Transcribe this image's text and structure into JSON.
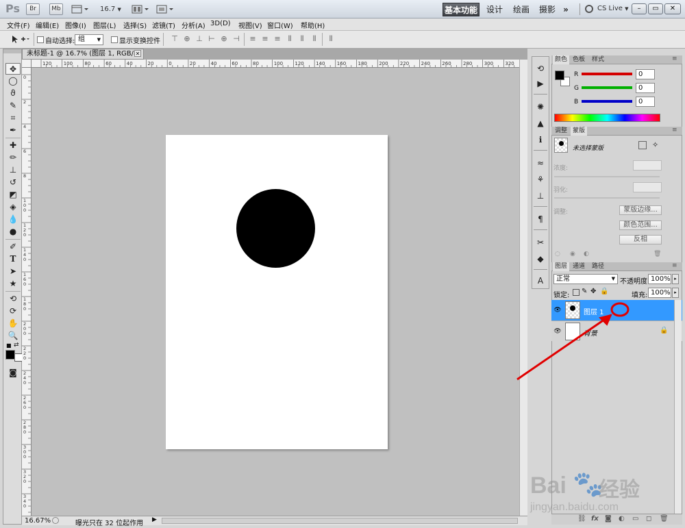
{
  "app": {
    "logo": "Ps",
    "bridge_btn": "Br",
    "minibridge_btn": "Mb",
    "zoom_value": "16.7",
    "zoom_arrow": "▼",
    "workspaces": [
      {
        "label": "基本功能",
        "active": true
      },
      {
        "label": "设计",
        "active": false
      },
      {
        "label": "绘画",
        "active": false
      },
      {
        "label": "摄影",
        "active": false
      }
    ],
    "more": "»",
    "cs_live": "CS Live",
    "win_min": "–",
    "win_max": "▭",
    "win_close": "✕"
  },
  "menu": [
    "文件(F)",
    "编辑(E)",
    "图像(I)",
    "图层(L)",
    "选择(S)",
    "滤镜(T)",
    "分析(A)",
    "3D(D)",
    "视图(V)",
    "窗口(W)",
    "帮助(H)"
  ],
  "options": {
    "auto_select_label": "自动选择:",
    "auto_select_value": "组",
    "show_transform_label": "显示变换控件"
  },
  "document": {
    "tab_title": "未标题-1 @ 16.7% (图层 1, RGB/8) *",
    "tab_close": "✕",
    "ruler_h": [
      "120",
      "100",
      "80",
      "60",
      "40",
      "20",
      "0",
      "20",
      "40",
      "60",
      "80",
      "100",
      "120",
      "140",
      "160",
      "180",
      "200",
      "220",
      "240",
      "260",
      "280",
      "300",
      "320"
    ],
    "ruler_v": [
      "0",
      "2",
      "4",
      "6",
      "8",
      "1 0 0",
      "1 2 0",
      "1 4 0",
      "1 6 0",
      "1 8 0",
      "2 0 0",
      "2 2 0",
      "2 4 0",
      "2 6 0",
      "2 8 0",
      "3 0 0",
      "3 2 0",
      "3 4 0"
    ],
    "canvas_color": "#ffffff",
    "shape_color": "#000000"
  },
  "status": {
    "zoom": "16.67%",
    "info": "曝光只在 32 位起作用",
    "arrow": "▶"
  },
  "color_panel": {
    "tabs": [
      "颜色",
      "色板",
      "样式"
    ],
    "channels": [
      {
        "name": "R",
        "value": "0",
        "color": "#d40000"
      },
      {
        "name": "G",
        "value": "0",
        "color": "#00b000"
      },
      {
        "name": "B",
        "value": "0",
        "color": "#0000c8"
      }
    ]
  },
  "masks_panel": {
    "tabs": [
      "调整",
      "蒙版"
    ],
    "no_mask": "未选择蒙版",
    "density_label": "浓度:",
    "feather_label": "羽化:",
    "refine_label": "调整:",
    "btn_edge": "蒙版边缘...",
    "btn_color_range": "颜色范围...",
    "btn_invert": "反相"
  },
  "layers_panel": {
    "tabs": [
      "图层",
      "通道",
      "路径"
    ],
    "blend_mode": "正常",
    "opacity_label": "不透明度:",
    "opacity_value": "100%",
    "lock_label": "锁定:",
    "fill_label": "填充:",
    "fill_value": "100%",
    "layers": [
      {
        "name": "图层 1",
        "selected": true
      },
      {
        "name": "背景",
        "selected": false
      }
    ],
    "selected_color": "#3399ff"
  },
  "annotation": {
    "color": "#e00000"
  },
  "watermark": {
    "line1": "Bai",
    "line2": "经验",
    "line3": "jingyan.baidu.com"
  }
}
